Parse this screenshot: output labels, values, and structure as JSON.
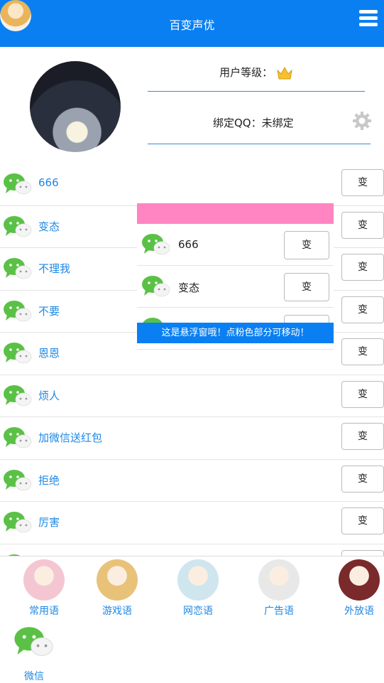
{
  "header": {
    "title": "百变声优",
    "menu_icon": "hamburger-icon"
  },
  "profile": {
    "level_label": "用户等级：",
    "qq_label": "绑定QQ：未绑定"
  },
  "list": {
    "button_label": "变",
    "items": [
      "666",
      "变态",
      "不理我",
      "不要",
      "恩恩",
      "烦人",
      "加微信送红包",
      "拒绝",
      "厉害"
    ]
  },
  "float_window": {
    "items": [
      "666",
      "变态"
    ],
    "button_label": "变",
    "banner": "这是悬浮窗哦！点粉色部分可移动！"
  },
  "categories": [
    {
      "name": "常用语",
      "color": "#f4c6d2"
    },
    {
      "name": "游戏语",
      "color": "#e9c27a"
    },
    {
      "name": "网恋语",
      "color": "#cfe6ef"
    },
    {
      "name": "广告语",
      "color": "#e8e8e8"
    },
    {
      "name": "外放语",
      "color": "#7a2a2a"
    },
    {
      "name": "微信",
      "color": "#4cd964"
    }
  ],
  "colors": {
    "primary": "#0a7ff2",
    "accent_link": "#1e88e5",
    "float_handle": "#ff84c2"
  }
}
